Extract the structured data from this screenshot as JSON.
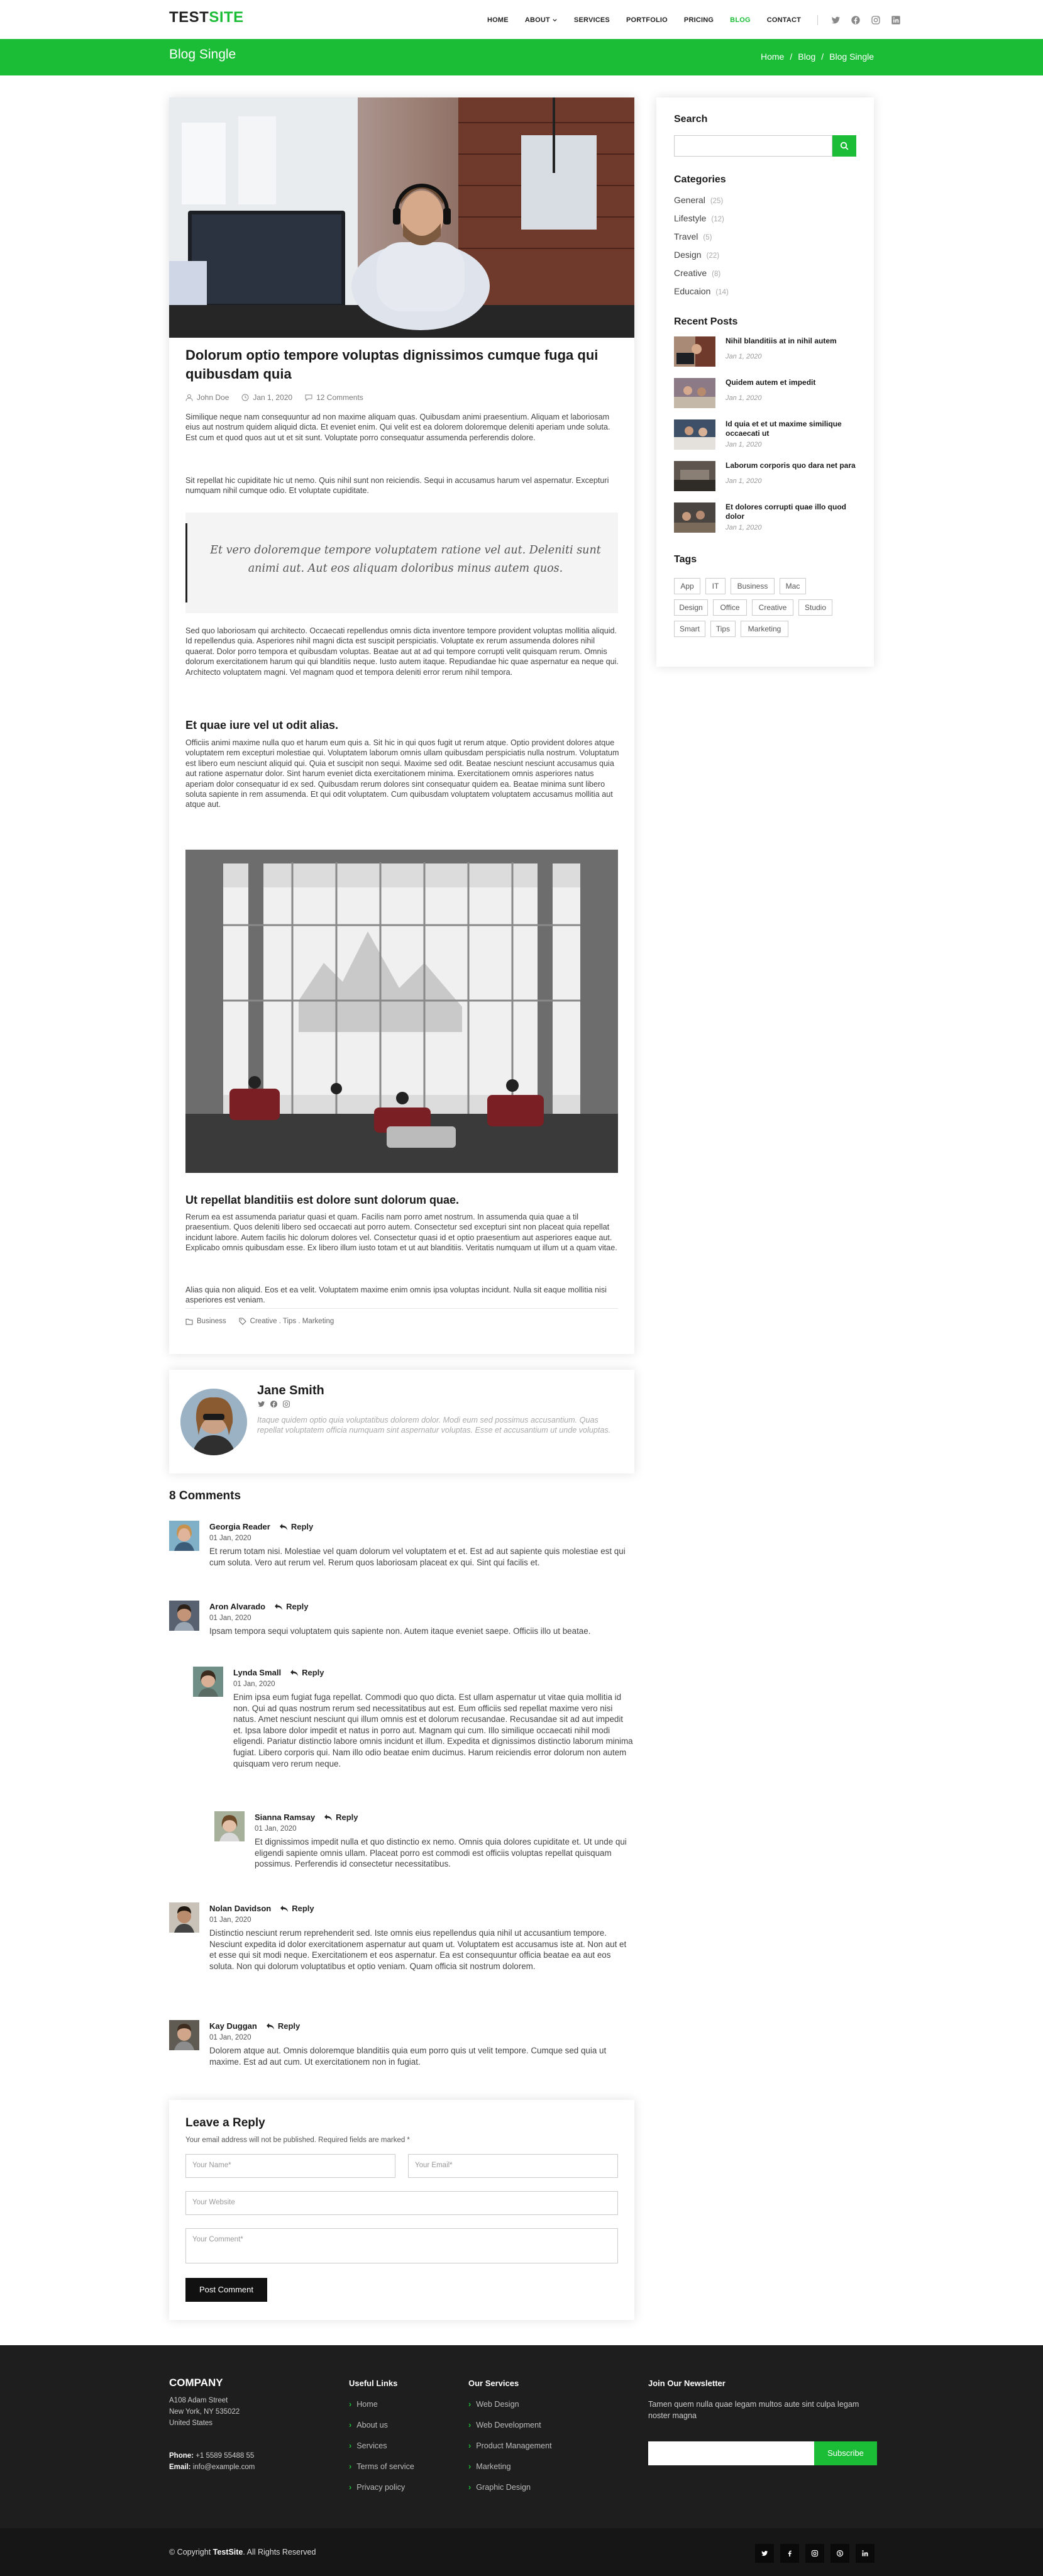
{
  "brand": {
    "part1": "TEST",
    "part2": "SITE",
    "accent": "#1bbd36"
  },
  "nav": {
    "items": [
      "HOME",
      "ABOUT",
      "SERVICES",
      "PORTFOLIO",
      "PRICING",
      "BLOG",
      "CONTACT"
    ],
    "active": "BLOG",
    "social_icons": [
      "twitter-icon",
      "facebook-icon",
      "instagram-icon",
      "linkedin-icon"
    ]
  },
  "page": {
    "title": "Blog Single",
    "breadcrumb": [
      "Home",
      "/",
      "Blog",
      "/",
      "Blog Single"
    ]
  },
  "article": {
    "title": "Dolorum optio tempore voluptas dignissimos cumque fuga qui quibusdam quia",
    "author": "John Doe",
    "date": "Jan 1, 2020",
    "comments": "12 Comments",
    "p1": "Similique neque nam consequuntur ad non maxime aliquam quas. Quibusdam animi praesentium. Aliquam et laboriosam eius aut nostrum quidem aliquid dicta. Et eveniet enim. Qui velit est ea dolorem doloremque deleniti aperiam unde soluta. Est cum et quod quos aut ut et sit sunt. Voluptate porro consequatur assumenda perferendis dolore.",
    "p2": "Sit repellat hic cupiditate hic ut nemo. Quis nihil sunt non reiciendis. Sequi in accusamus harum vel aspernatur. Excepturi numquam nihil cumque odio. Et voluptate cupiditate.",
    "quote": "Et vero doloremque tempore voluptatem ratione vel aut. Deleniti sunt animi aut. Aut eos aliquam doloribus minus autem quos.",
    "p3": "Sed quo laboriosam qui architecto. Occaecati repellendus omnis dicta inventore tempore provident voluptas mollitia aliquid. Id repellendus quia. Asperiores nihil magni dicta est suscipit perspiciatis. Voluptate ex rerum assumenda dolores nihil quaerat. Dolor porro tempora et quibusdam voluptas. Beatae aut at ad qui tempore corrupti velit quisquam rerum. Omnis dolorum exercitationem harum qui qui blanditiis neque. Iusto autem itaque. Repudiandae hic quae aspernatur ea neque qui. Architecto voluptatem magni. Vel magnam quod et tempora deleniti error rerum nihil tempora.",
    "h1": "Et quae iure vel ut odit alias.",
    "p4": "Officiis animi maxime nulla quo et harum eum quis a. Sit hic in qui quos fugit ut rerum atque. Optio provident dolores atque voluptatem rem excepturi molestiae qui. Voluptatem laborum omnis ullam quibusdam perspiciatis nulla nostrum. Voluptatum est libero eum nesciunt aliquid qui. Quia et suscipit non sequi. Maxime sed odit. Beatae nesciunt nesciunt accusamus quia aut ratione aspernatur dolor. Sint harum eveniet dicta exercitationem minima. Exercitationem omnis asperiores natus aperiam dolor consequatur id ex sed. Quibusdam rerum dolores sint consequatur quidem ea. Beatae minima sunt libero soluta sapiente in rem assumenda. Et qui odit voluptatem. Cum quibusdam voluptatem voluptatem accusamus mollitia aut atque aut.",
    "h2": "Ut repellat blanditiis est dolore sunt dolorum quae.",
    "p5": "Rerum ea est assumenda pariatur quasi et quam. Facilis nam porro amet nostrum. In assumenda quia quae a til praesentium. Quos deleniti libero sed occaecati aut porro autem. Consectetur sed excepturi sint non placeat quia repellat incidunt labore. Autem facilis hic dolorum dolores vel. Consectetur quasi id et optio praesentium aut asperiores eaque aut. Explicabo omnis quibusdam esse. Ex libero illum iusto totam et ut aut blanditiis. Veritatis numquam ut illum ut a quam vitae.",
    "p6": "Alias quia non aliquid. Eos et ea velit. Voluptatem maxime enim omnis ipsa voluptas incidunt. Nulla sit eaque mollitia nisi asperiores est veniam.",
    "category": "Business",
    "tags": "Creative . Tips . Marketing"
  },
  "author_box": {
    "name": "Jane Smith",
    "bio": "Itaque quidem optio quia voluptatibus dolorem dolor. Modi eum sed possimus accusantium. Quas repellat voluptatem officia numquam sint aspernatur voluptas. Esse et accusantium ut unde voluptas."
  },
  "comments": {
    "title": "8 Comments",
    "reply_label": "Reply",
    "items": [
      {
        "name": "Georgia Reader",
        "date": "01 Jan, 2020",
        "text": "Et rerum totam nisi. Molestiae vel quam dolorum vel voluptatem et et. Est ad aut sapiente quis molestiae est qui cum soluta. Vero aut rerum vel. Rerum quos laboriosam placeat ex qui. Sint qui facilis et."
      },
      {
        "name": "Aron Alvarado",
        "date": "01 Jan, 2020",
        "text": "Ipsam tempora sequi voluptatem quis sapiente non. Autem itaque eveniet saepe. Officiis illo ut beatae."
      },
      {
        "name": "Lynda Small",
        "date": "01 Jan, 2020",
        "text": "Enim ipsa eum fugiat fuga repellat. Commodi quo quo dicta. Est ullam aspernatur ut vitae quia mollitia id non. Qui ad quas nostrum rerum sed necessitatibus aut est. Eum officiis sed repellat maxime vero nisi natus. Amet nesciunt nesciunt qui illum omnis est et dolorum recusandae. Recusandae sit ad aut impedit et. Ipsa labore dolor impedit et natus in porro aut. Magnam qui cum. Illo similique occaecati nihil modi eligendi. Pariatur distinctio labore omnis incidunt et illum. Expedita et dignissimos distinctio laborum minima fugiat. Libero corporis qui. Nam illo odio beatae enim ducimus. Harum reiciendis error dolorum non autem quisquam vero rerum neque."
      },
      {
        "name": "Sianna Ramsay",
        "date": "01 Jan, 2020",
        "text": "Et dignissimos impedit nulla et quo distinctio ex nemo. Omnis quia dolores cupiditate et. Ut unde qui eligendi sapiente omnis ullam. Placeat porro est commodi est officiis voluptas repellat quisquam possimus. Perferendis id consectetur necessitatibus."
      },
      {
        "name": "Nolan Davidson",
        "date": "01 Jan, 2020",
        "text": "Distinctio nesciunt rerum reprehenderit sed. Iste omnis eius repellendus quia nihil ut accusantium tempore. Nesciunt expedita id dolor exercitationem aspernatur aut quam ut. Voluptatem est accusamus iste at. Non aut et et esse qui sit modi neque. Exercitationem et eos aspernatur. Ea est consequuntur officia beatae ea aut eos soluta. Non qui dolorum voluptatibus et optio veniam. Quam officia sit nostrum dolorem."
      },
      {
        "name": "Kay Duggan",
        "date": "01 Jan, 2020",
        "text": "Dolorem atque aut. Omnis doloremque blanditiis quia eum porro quis ut velit tempore. Cumque sed quia ut maxime. Est ad aut cum. Ut exercitationem non in fugiat."
      }
    ]
  },
  "reply_form": {
    "title": "Leave a Reply",
    "note": "Your email address will not be published. Required fields are marked *",
    "name_ph": "Your Name*",
    "email_ph": "Your Email*",
    "website_ph": "Your Website",
    "comment_ph": "Your Comment*",
    "submit": "Post Comment"
  },
  "sidebar": {
    "search_title": "Search",
    "categories_title": "Categories",
    "categories": [
      {
        "name": "General",
        "count": "(25)"
      },
      {
        "name": "Lifestyle",
        "count": "(12)"
      },
      {
        "name": "Travel",
        "count": "(5)"
      },
      {
        "name": "Design",
        "count": "(22)"
      },
      {
        "name": "Creative",
        "count": "(8)"
      },
      {
        "name": "Educaion",
        "count": "(14)"
      }
    ],
    "recent_title": "Recent Posts",
    "recent": [
      {
        "title": "Nihil blanditiis at in nihil autem",
        "date": "Jan 1, 2020"
      },
      {
        "title": "Quidem autem et impedit",
        "date": "Jan 1, 2020"
      },
      {
        "title": "Id quia et et ut maxime similique occaecati ut",
        "date": "Jan 1, 2020"
      },
      {
        "title": "Laborum corporis quo dara net para",
        "date": "Jan 1, 2020"
      },
      {
        "title": "Et dolores corrupti quae illo quod dolor",
        "date": "Jan 1, 2020"
      }
    ],
    "tags_title": "Tags",
    "tags": [
      "App",
      "IT",
      "Business",
      "Mac",
      "Design",
      "Office",
      "Creative",
      "Studio",
      "Smart",
      "Tips",
      "Marketing"
    ]
  },
  "footer": {
    "company": "COMPANY",
    "address1": "A108 Adam Street",
    "address2": "New York, NY 535022",
    "address3": "United States",
    "phone_label": "Phone:",
    "phone": "+1 5589 55488 55",
    "email_label": "Email:",
    "email": "info@example.com",
    "links_title": "Useful Links",
    "links": [
      "Home",
      "About us",
      "Services",
      "Terms of service",
      "Privacy policy"
    ],
    "services_title": "Our Services",
    "services": [
      "Web Design",
      "Web Development",
      "Product Management",
      "Marketing",
      "Graphic Design"
    ],
    "newsletter_title": "Join Our Newsletter",
    "newsletter_text": "Tamen quem nulla quae legam multos aute sint culpa legam noster magna",
    "subscribe": "Subscribe",
    "copyright_pre": "© Copyright",
    "copyright_brand": "TestSite",
    "copyright_post": ". All Rights Reserved",
    "social_icons": [
      "twitter-icon",
      "facebook-icon",
      "instagram-icon",
      "skype-icon",
      "linkedin-icon"
    ]
  }
}
